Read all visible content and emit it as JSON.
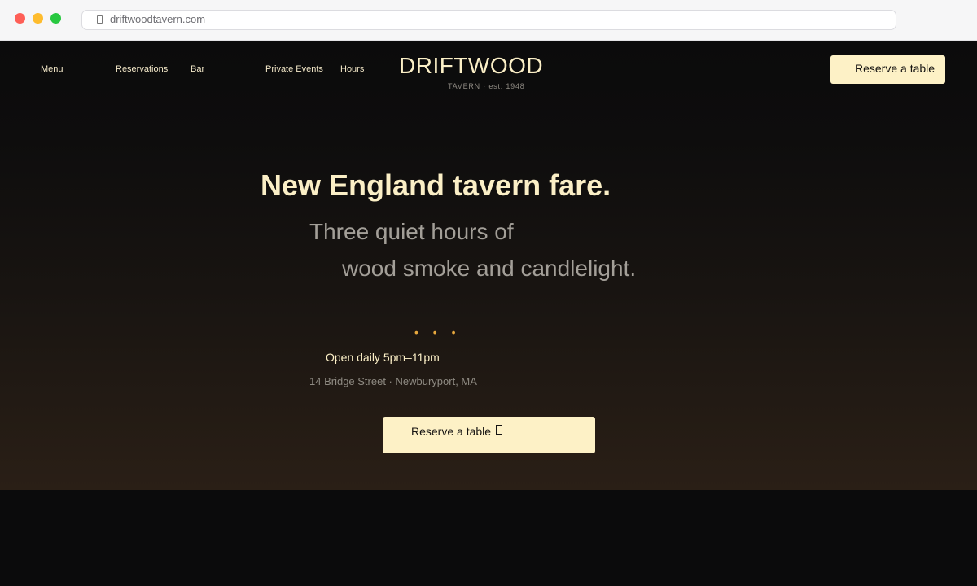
{
  "browser": {
    "url": "driftwoodtavern.com"
  },
  "nav": {
    "links": [
      "Menu",
      "Reservations",
      "Bar",
      "Private Events",
      "Hours"
    ],
    "cta": "Reserve a table"
  },
  "brand": {
    "name": "DRIFTWOOD",
    "sub": "TAVERN  ·  est. 1948"
  },
  "hero": {
    "headline": "New England tavern fare.",
    "subline_1": "Three quiet hours of",
    "subline_2": "wood smoke and candlelight.",
    "divider": "• • •",
    "hours": "Open daily 5pm–11pm",
    "address": "14 Bridge Street · Newburyport, MA",
    "cta": "Reserve a table"
  },
  "icons": {
    "lock": "lock-icon",
    "cta_arrow": "arrow-icon"
  },
  "colors": {
    "accent": "#fdf1c6",
    "gold": "#e7a83e",
    "background": "#0b0b0c"
  }
}
